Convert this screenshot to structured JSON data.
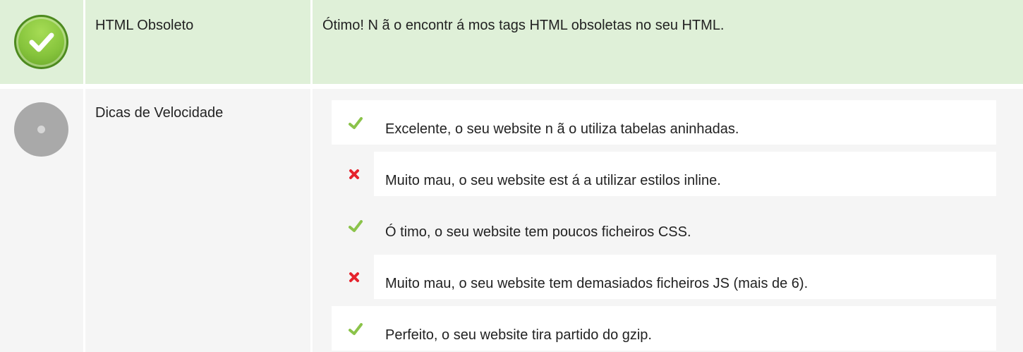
{
  "rows": [
    {
      "status": "ok",
      "status_icon": "check-circle-icon",
      "label": "HTML Obsoleto",
      "message": "Ótimo! N ã o encontr á mos tags HTML obsoletas no seu HTML."
    },
    {
      "status": "neutral",
      "status_icon": "neutral-circle-icon",
      "label": "Dicas de Velocidade",
      "tips": [
        {
          "status": "pass",
          "icon": "check-icon",
          "text": "Excelente, o seu website n ã o utiliza tabelas aninhadas."
        },
        {
          "status": "fail",
          "icon": "cross-icon",
          "text": "Muito mau, o seu website est á  a utilizar estilos inline."
        },
        {
          "status": "pass",
          "icon": "check-icon",
          "text": "Ó timo, o seu website tem poucos ficheiros CSS."
        },
        {
          "status": "fail",
          "icon": "cross-icon",
          "text": "Muito mau, o seu website tem demasiados ficheiros JS (mais de 6)."
        },
        {
          "status": "pass",
          "icon": "check-icon",
          "text": "Perfeito, o seu website tira partido do gzip."
        }
      ]
    }
  ],
  "colors": {
    "pass_row_bg": "#dff0d8",
    "neutral_row_bg": "#f5f5f5",
    "check_green": "#8bc34a",
    "cross_red": "#e5232d"
  }
}
